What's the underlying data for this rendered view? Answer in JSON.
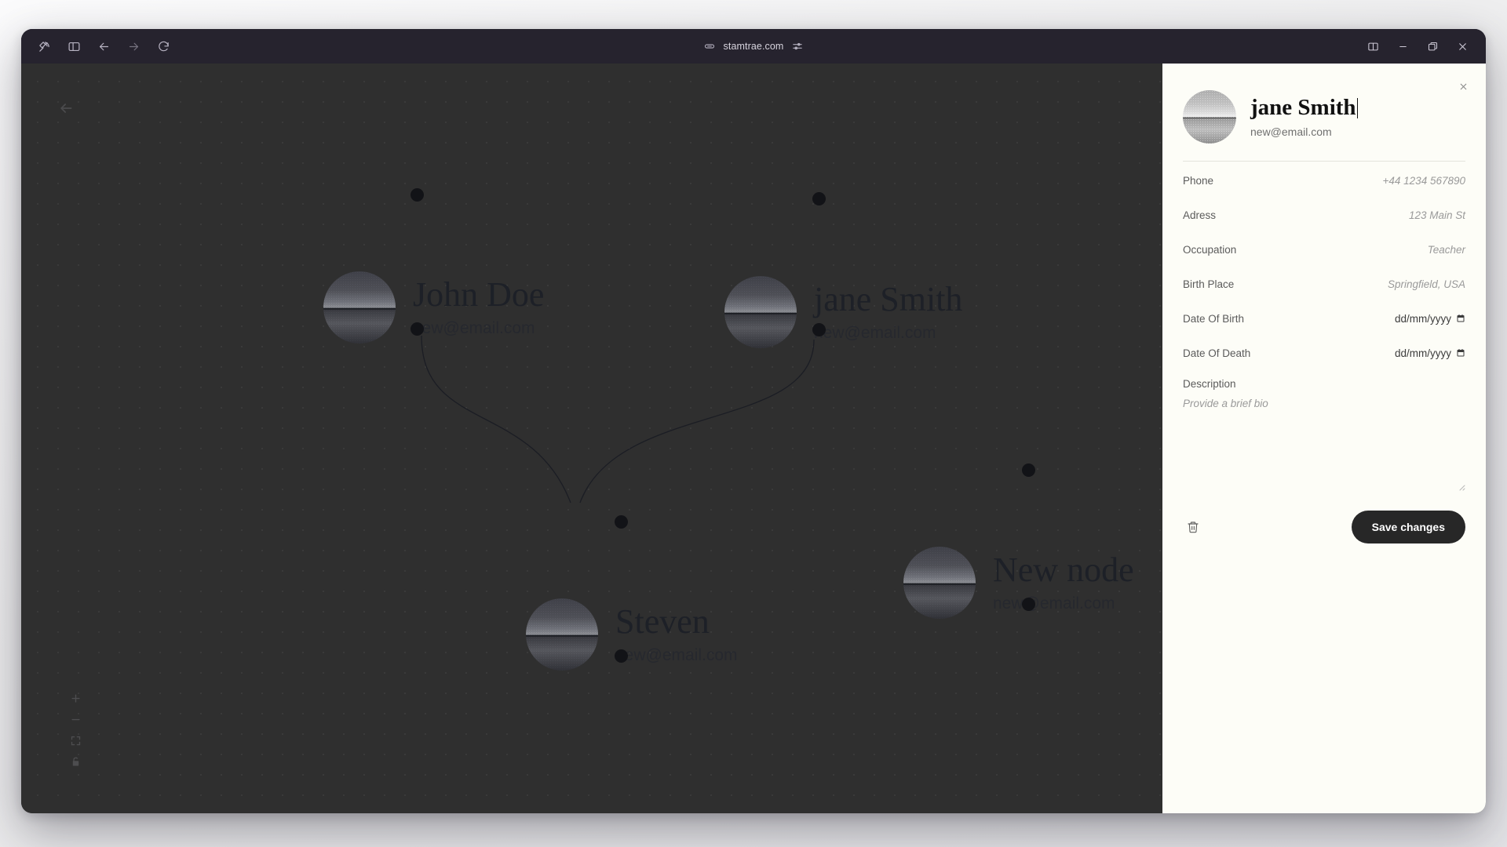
{
  "browser": {
    "url": "stamtrae.com",
    "toolbar": {
      "app_icon": "satellite-icon",
      "sidebar_toggle": "sidebar-panel-icon",
      "back": "back-arrow-icon",
      "forward": "forward-arrow-icon",
      "reload": "reload-icon",
      "link": "link-icon",
      "tune": "sliders-icon"
    },
    "window_controls": {
      "split": "split-pane-icon",
      "minimize": "minimize-icon",
      "maximize": "maximize-icon",
      "close": "close-icon"
    }
  },
  "canvas": {
    "back_label": "back-arrow",
    "controls": [
      {
        "name": "zoom-in",
        "glyph": "+"
      },
      {
        "name": "zoom-out",
        "glyph": "−"
      },
      {
        "name": "fit-view",
        "glyph": "fit"
      },
      {
        "name": "lock",
        "glyph": "lock"
      }
    ],
    "nodes": [
      {
        "id": "john",
        "name": "John Doe",
        "email": "new@email.com"
      },
      {
        "id": "jane",
        "name": "jane Smith",
        "email": "new@email.com"
      },
      {
        "id": "steven",
        "name": "Steven",
        "email": "new@email.com"
      },
      {
        "id": "new",
        "name": "New node",
        "email": "new@email.com"
      }
    ]
  },
  "panel": {
    "person": {
      "name": "jane Smith",
      "email": "new@email.com"
    },
    "fields": [
      {
        "label": "Phone",
        "value": "+44 1234 567890",
        "type": "text"
      },
      {
        "label": "Adress",
        "value": "123 Main St",
        "type": "text"
      },
      {
        "label": "Occupation",
        "value": "Teacher",
        "type": "text"
      },
      {
        "label": "Birth Place",
        "value": "Springfield, USA",
        "type": "text"
      },
      {
        "label": "Date Of Birth",
        "value": "dd/mm/yyyy",
        "type": "date"
      },
      {
        "label": "Date Of Death",
        "value": "dd/mm/yyyy",
        "type": "date"
      }
    ],
    "description": {
      "label": "Description",
      "placeholder": "Provide a brief bio"
    },
    "footer": {
      "delete_icon": "trash-icon",
      "save_label": "Save changes"
    },
    "close_icon": "close-icon"
  },
  "colors": {
    "panel_bg": "#fdfdf7",
    "canvas_bg": "#2f2f2f",
    "titlebar_bg": "#26232e",
    "save_button": "#272727",
    "node_name": "#1d2027"
  }
}
